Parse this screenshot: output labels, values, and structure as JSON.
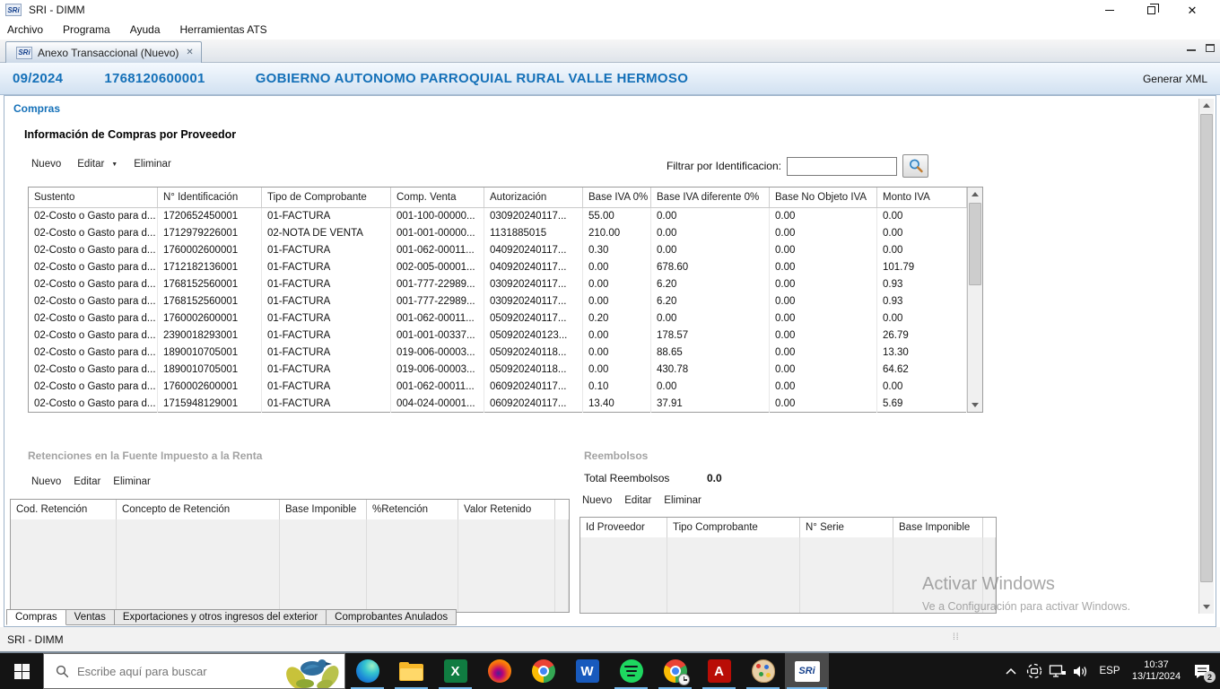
{
  "colors": {
    "accent_blue": "#1470b8",
    "header_gradient_top": "#f4f9fe",
    "header_gradient_bottom": "#d2e1f1",
    "taskbar_bg": "#141414",
    "run_indicator": "#76b9ed",
    "section_gray": "#a3a3a3"
  },
  "icons": {
    "close_x": "✕",
    "tab_close_x": "✕",
    "dropdown_arrow": "▼"
  },
  "window": {
    "title": "SRI - DIMM",
    "logo": "SRi"
  },
  "menu_bar": {
    "items": [
      "Archivo",
      "Programa",
      "Ayuda",
      "Herramientas ATS"
    ]
  },
  "tab_bar": {
    "active_tab": "Anexo Transaccional (Nuevo)",
    "tab_logo": "SRi"
  },
  "header": {
    "period": "09/2024",
    "ruc": "1768120600001",
    "entity": "GOBIERNO AUTONOMO PARROQUIAL RURAL VALLE HERMOSO",
    "generate_xml": "Generar XML"
  },
  "compras": {
    "section_label": "Compras",
    "title": "Información de Compras por Proveedor",
    "toolbar": {
      "nuevo": "Nuevo",
      "editar": "Editar",
      "eliminar": "Eliminar"
    },
    "filter": {
      "label": "Filtrar por Identificacion:",
      "value": ""
    },
    "table": {
      "columns": [
        "Sustento",
        "N° Identificación",
        "Tipo de Comprobante",
        "Comp. Venta",
        "Autorización",
        "Base IVA 0%",
        "Base IVA diferente 0%",
        "Base No Objeto IVA",
        "Monto IVA"
      ],
      "rows": [
        [
          "02-Costo o Gasto para d...",
          "1720652450001",
          "01-FACTURA",
          "001-100-00000...",
          "030920240117...",
          "55.00",
          "0.00",
          "0.00",
          "0.00"
        ],
        [
          "02-Costo o Gasto para d...",
          "1712979226001",
          "02-NOTA DE VENTA",
          "001-001-00000...",
          "1131885015",
          "210.00",
          "0.00",
          "0.00",
          "0.00"
        ],
        [
          "02-Costo o Gasto para d...",
          "1760002600001",
          "01-FACTURA",
          "001-062-00011...",
          "040920240117...",
          "0.30",
          "0.00",
          "0.00",
          "0.00"
        ],
        [
          "02-Costo o Gasto para d...",
          "1712182136001",
          "01-FACTURA",
          "002-005-00001...",
          "040920240117...",
          "0.00",
          "678.60",
          "0.00",
          "101.79"
        ],
        [
          "02-Costo o Gasto para d...",
          "1768152560001",
          "01-FACTURA",
          "001-777-22989...",
          "030920240117...",
          "0.00",
          "6.20",
          "0.00",
          "0.93"
        ],
        [
          "02-Costo o Gasto para d...",
          "1768152560001",
          "01-FACTURA",
          "001-777-22989...",
          "030920240117...",
          "0.00",
          "6.20",
          "0.00",
          "0.93"
        ],
        [
          "02-Costo o Gasto para d...",
          "1760002600001",
          "01-FACTURA",
          "001-062-00011...",
          "050920240117...",
          "0.20",
          "0.00",
          "0.00",
          "0.00"
        ],
        [
          "02-Costo o Gasto para d...",
          "2390018293001",
          "01-FACTURA",
          "001-001-00337...",
          "050920240123...",
          "0.00",
          "178.57",
          "0.00",
          "26.79"
        ],
        [
          "02-Costo o Gasto para d...",
          "1890010705001",
          "01-FACTURA",
          "019-006-00003...",
          "050920240118...",
          "0.00",
          "88.65",
          "0.00",
          "13.30"
        ],
        [
          "02-Costo o Gasto para d...",
          "1890010705001",
          "01-FACTURA",
          "019-006-00003...",
          "050920240118...",
          "0.00",
          "430.78",
          "0.00",
          "64.62"
        ],
        [
          "02-Costo o Gasto para d...",
          "1760002600001",
          "01-FACTURA",
          "001-062-00011...",
          "060920240117...",
          "0.10",
          "0.00",
          "0.00",
          "0.00"
        ],
        [
          "02-Costo o Gasto para d...",
          "1715948129001",
          "01-FACTURA",
          "004-024-00001...",
          "060920240117...",
          "13.40",
          "37.91",
          "0.00",
          "5.69"
        ]
      ]
    }
  },
  "retenciones": {
    "title": "Retenciones en la Fuente  Impuesto a la Renta",
    "toolbar": {
      "nuevo": "Nuevo",
      "editar": "Editar",
      "eliminar": "Eliminar"
    },
    "columns": [
      "Cod. Retención",
      "Concepto de Retención",
      "Base Imponible",
      "%Retención",
      "Valor Retenido"
    ]
  },
  "reembolsos": {
    "title": "Reembolsos",
    "total_label": "Total Reembolsos",
    "total_value": "0.0",
    "toolbar": {
      "nuevo": "Nuevo",
      "editar": "Editar",
      "eliminar": "Eliminar"
    },
    "columns": [
      "Id Proveedor",
      "Tipo Comprobante",
      "N° Serie",
      "Base Imponible"
    ]
  },
  "bottom_tabs": {
    "items": [
      "Compras",
      "Ventas",
      "Exportaciones y otros ingresos del exterior",
      "Comprobantes Anulados"
    ],
    "active": "Compras"
  },
  "status_bar": {
    "text": "SRI - DIMM"
  },
  "watermark": {
    "line1": "Activar Windows",
    "line2": "Ve a Configuración para activar Windows."
  },
  "taskbar": {
    "search": {
      "placeholder": "Escribe aquí para buscar"
    },
    "apps": [
      {
        "name": "edge",
        "running": true
      },
      {
        "name": "file-explorer",
        "running": true
      },
      {
        "name": "excel",
        "glyph": "X",
        "running": true
      },
      {
        "name": "firefox",
        "running": false
      },
      {
        "name": "chrome",
        "running": false
      },
      {
        "name": "word",
        "glyph": "W",
        "running": false
      },
      {
        "name": "spotify",
        "running": true
      },
      {
        "name": "chrome-profile",
        "running": true
      },
      {
        "name": "acrobat",
        "glyph": "A",
        "running": true
      },
      {
        "name": "paint",
        "running": true
      },
      {
        "name": "sri",
        "glyph": "SRi",
        "running": true,
        "active": true
      }
    ],
    "tray": {
      "language": "ESP",
      "time": "10:37",
      "date": "13/11/2024",
      "notification_count": "2"
    }
  }
}
